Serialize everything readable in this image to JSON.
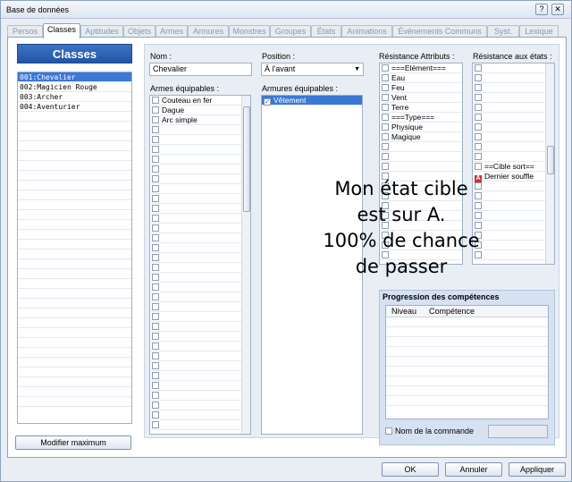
{
  "window": {
    "title": "Base de données"
  },
  "tabs": [
    "Persos",
    "Classes",
    "Aptitudes",
    "Objets",
    "Armes",
    "Armures",
    "Monstres",
    "Groupes",
    "États",
    "Animations",
    "Événements Communs",
    "Syst.",
    "Lexique"
  ],
  "classes_panel": {
    "header": "Classes",
    "items": [
      "001:Chevalier",
      "002:Magicien Rouge",
      "003:Archer",
      "004:Aventurier"
    ],
    "modify_max_button": "Modifier maximum"
  },
  "editor": {
    "name_label": "Nom :",
    "name_value": "Chevalier",
    "position_label": "Position :",
    "position_value": "À l'avant",
    "weapons_label": "Armes équipables :",
    "weapons": [
      "Couteau en fer",
      "Dague",
      "Arc simple"
    ],
    "armors_label": "Armures équipables :",
    "armors": [
      "Vêtement"
    ],
    "attr_label": "Résistance Attributs :",
    "attributes": [
      "===Elément===",
      "Eau",
      "Feu",
      "Vent",
      "Terre",
      "===Type===",
      "Physique",
      "Magique"
    ],
    "states_label": "Résistance aux états :",
    "states_special": [
      "==Cible sort==",
      "Dernier souffle"
    ],
    "skills_group_title": "Progression des compétences",
    "skills_col_level": "Niveau",
    "skills_col_skill": "Compétence",
    "command_name_label": "Nom de la commande"
  },
  "overlay_text": [
    "Mon état cible",
    "est sur A.",
    "100% de chance",
    "de passer"
  ],
  "footer": {
    "ok": "OK",
    "cancel": "Annuler",
    "apply": "Appliquer"
  }
}
